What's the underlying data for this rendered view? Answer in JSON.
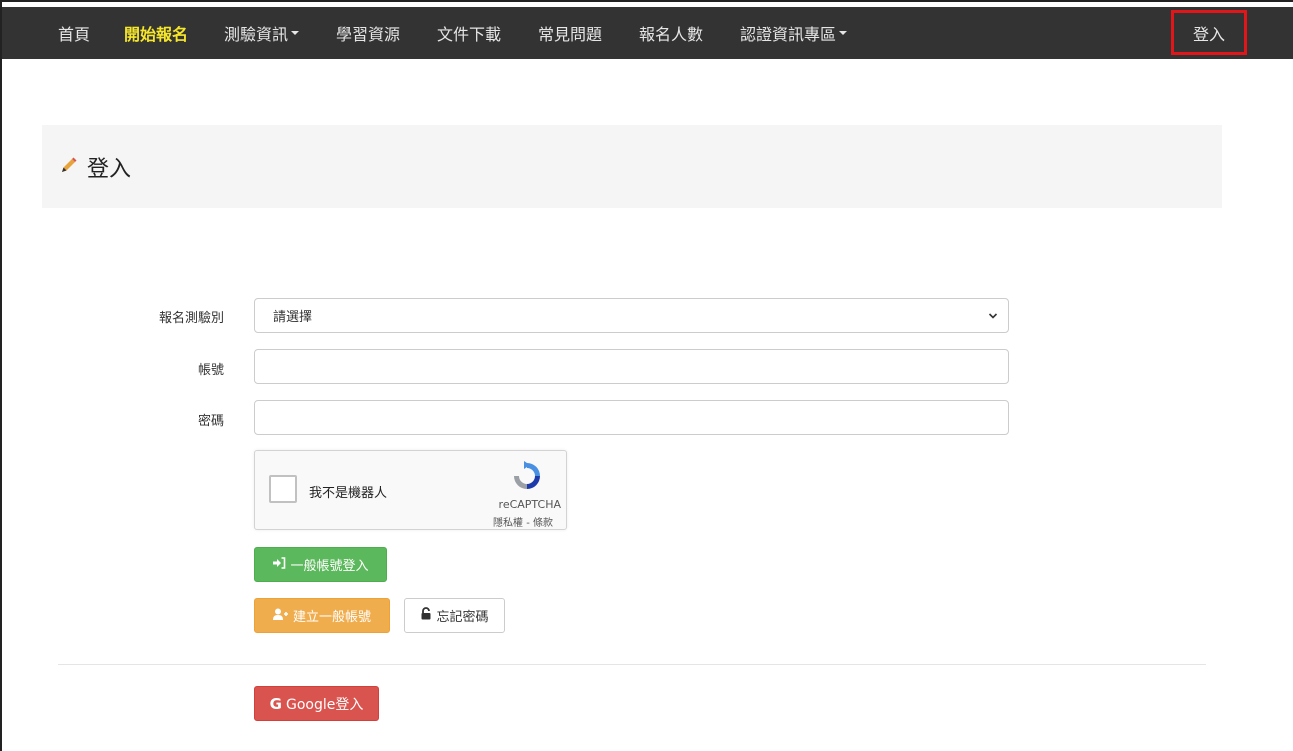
{
  "navbar": {
    "items": [
      {
        "label": "首頁",
        "active": false,
        "dropdown": false
      },
      {
        "label": "開始報名",
        "active": true,
        "dropdown": false
      },
      {
        "label": "測驗資訊",
        "active": false,
        "dropdown": true
      },
      {
        "label": "學習資源",
        "active": false,
        "dropdown": false
      },
      {
        "label": "文件下載",
        "active": false,
        "dropdown": false
      },
      {
        "label": "常見問題",
        "active": false,
        "dropdown": false
      },
      {
        "label": "報名人數",
        "active": false,
        "dropdown": false
      },
      {
        "label": "認證資訊專區",
        "active": false,
        "dropdown": true
      }
    ],
    "login_label": "登入",
    "colors": {
      "background": "#333333",
      "active": "#f5e62b",
      "highlight_border": "#e0161b"
    }
  },
  "panel": {
    "title": "登入",
    "icon": "pencil-icon"
  },
  "form": {
    "exam_type_label": "報名測驗別",
    "exam_type_selected": "請選擇",
    "account_label": "帳號",
    "account_value": "",
    "password_label": "密碼",
    "password_value": ""
  },
  "recaptcha": {
    "label": "我不是機器人",
    "brand": "reCAPTCHA",
    "links": "隱私權 - 條款"
  },
  "buttons": {
    "general_login": "一般帳號登入",
    "create_account": "建立一般帳號",
    "forgot_password": "忘記密碼",
    "google_login": "Google登入",
    "google_glyph": "G"
  }
}
